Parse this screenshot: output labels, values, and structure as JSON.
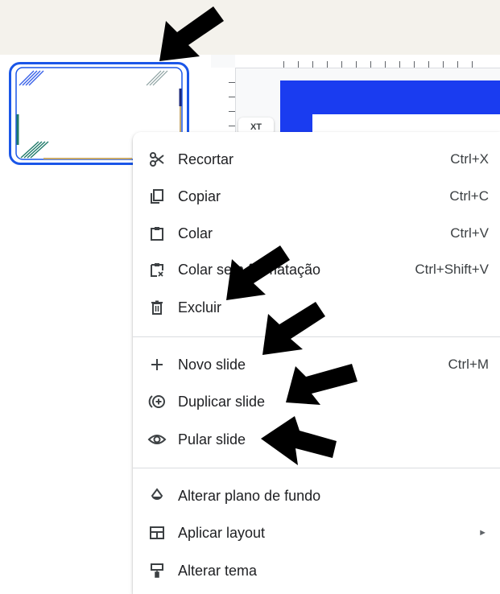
{
  "side_chip": {
    "label": "XT"
  },
  "context_menu": {
    "items": [
      {
        "label": "Recortar",
        "shortcut": "Ctrl+X",
        "icon": "scissors-icon"
      },
      {
        "label": "Copiar",
        "shortcut": "Ctrl+C",
        "icon": "copy-icon"
      },
      {
        "label": "Colar",
        "shortcut": "Ctrl+V",
        "icon": "clipboard-icon"
      },
      {
        "label": "Colar sem formatação",
        "shortcut": "Ctrl+Shift+V",
        "icon": "clipboard-plain-icon"
      },
      {
        "label": "Excluir",
        "shortcut": "",
        "icon": "trash-icon"
      },
      {
        "label": "Novo slide",
        "shortcut": "Ctrl+M",
        "icon": "plus-icon"
      },
      {
        "label": "Duplicar slide",
        "shortcut": "",
        "icon": "duplicate-icon"
      },
      {
        "label": "Pular slide",
        "shortcut": "",
        "icon": "eye-icon"
      },
      {
        "label": "Alterar plano de fundo",
        "shortcut": "",
        "icon": "paint-drop-icon"
      },
      {
        "label": "Aplicar layout",
        "shortcut": "",
        "submenu_indicator": "►",
        "icon": "layout-icon"
      },
      {
        "label": "Alterar tema",
        "shortcut": "",
        "icon": "paint-roller-icon"
      }
    ]
  },
  "colors": {
    "background": "#f4f2ec",
    "thumbnail_border": "#1a56e8",
    "slide_blue": "#1a3cf0",
    "annotation_arrow": "#000000"
  }
}
